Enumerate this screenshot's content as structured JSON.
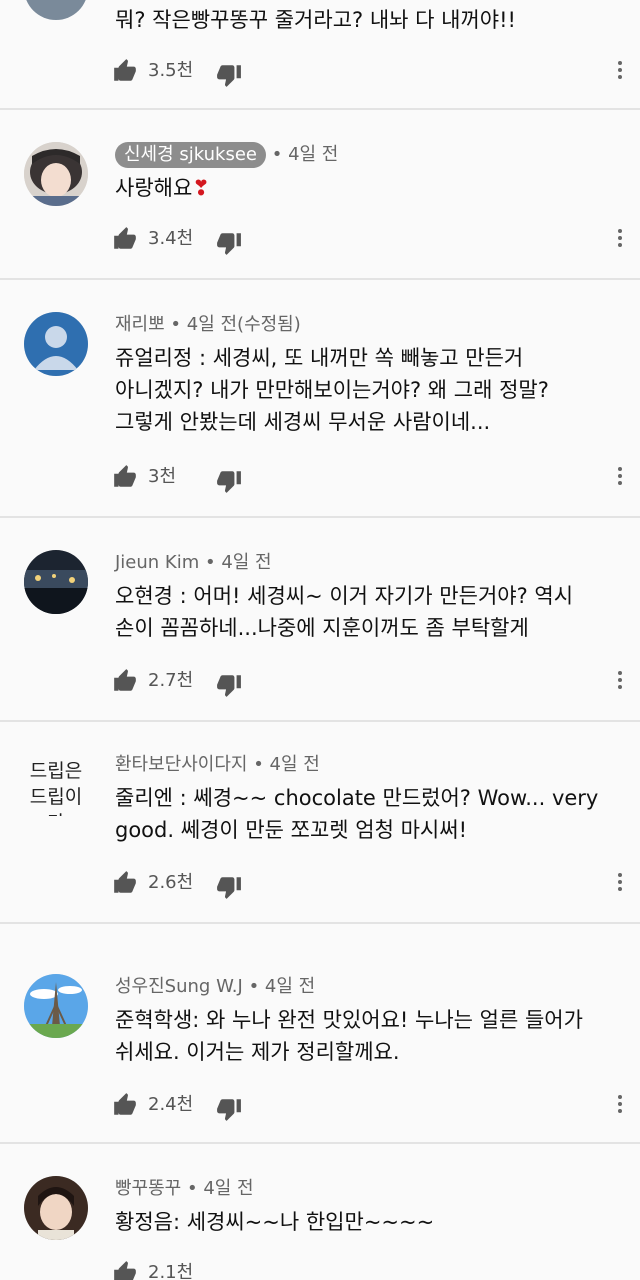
{
  "comments": [
    {
      "author": "",
      "time": "",
      "text": "뭐? 작은빵꾸똥꾸 줄거라고? 내놔 다 내꺼야!!",
      "likes": "3.5천"
    },
    {
      "author": "신세경 sjkuksee",
      "time": "4일 전",
      "text": "사랑해요",
      "emoji": "❣",
      "likes": "3.4천"
    },
    {
      "author": "재리뽀",
      "time": "4일 전(수정됨)",
      "text": "쥬얼리정 : 세경씨, 또 내꺼만 쏙 빼놓고 만든거\n아니겠지? 내가 만만해보이는거야? 왜 그래 정말?\n그렇게 안봤는데 세경씨 무서운 사람이네...",
      "likes": "3천"
    },
    {
      "author": "Jieun Kim",
      "time": "4일 전",
      "text": "오현경 : 어머! 세경씨~ 이거 자기가 만든거야? 역시\n손이 꼼꼼하네...나중에 지훈이꺼도 좀 부탁할게",
      "likes": "2.7천"
    },
    {
      "author": "환타보단사이다지",
      "time": "4일 전",
      "avatar_text": [
        "드립은",
        "드립이다"
      ],
      "text": "줄리엔 : 쎄경~~ chocolate 만드렀어? Wow... very\ngood. 쎄경이 만둔 쪼꼬렛 엄청 마시써!",
      "likes": "2.6천"
    },
    {
      "author": "성우진Sung W.J",
      "time": "4일 전",
      "text": "준혁학생: 와 누나 완전 맛있어요! 누나는 얼른 들어가\n쉬세요. 이거는 제가 정리할께요.",
      "likes": "2.4천"
    },
    {
      "author": "빵꾸똥꾸",
      "time": "4일 전",
      "text": "황정음: 세경씨~~나 한입만~~~~",
      "likes": "2.1천"
    }
  ],
  "separator": " • ",
  "icons": {
    "like": "thumbs-up-icon",
    "dislike": "thumbs-down-icon",
    "more": "more-vertical-icon"
  },
  "colors": {
    "background": "#fafafa",
    "divider": "#e3e3e3",
    "author_pill": "#8d8d8d",
    "icon": "#555555",
    "heart": "#d4171f"
  }
}
